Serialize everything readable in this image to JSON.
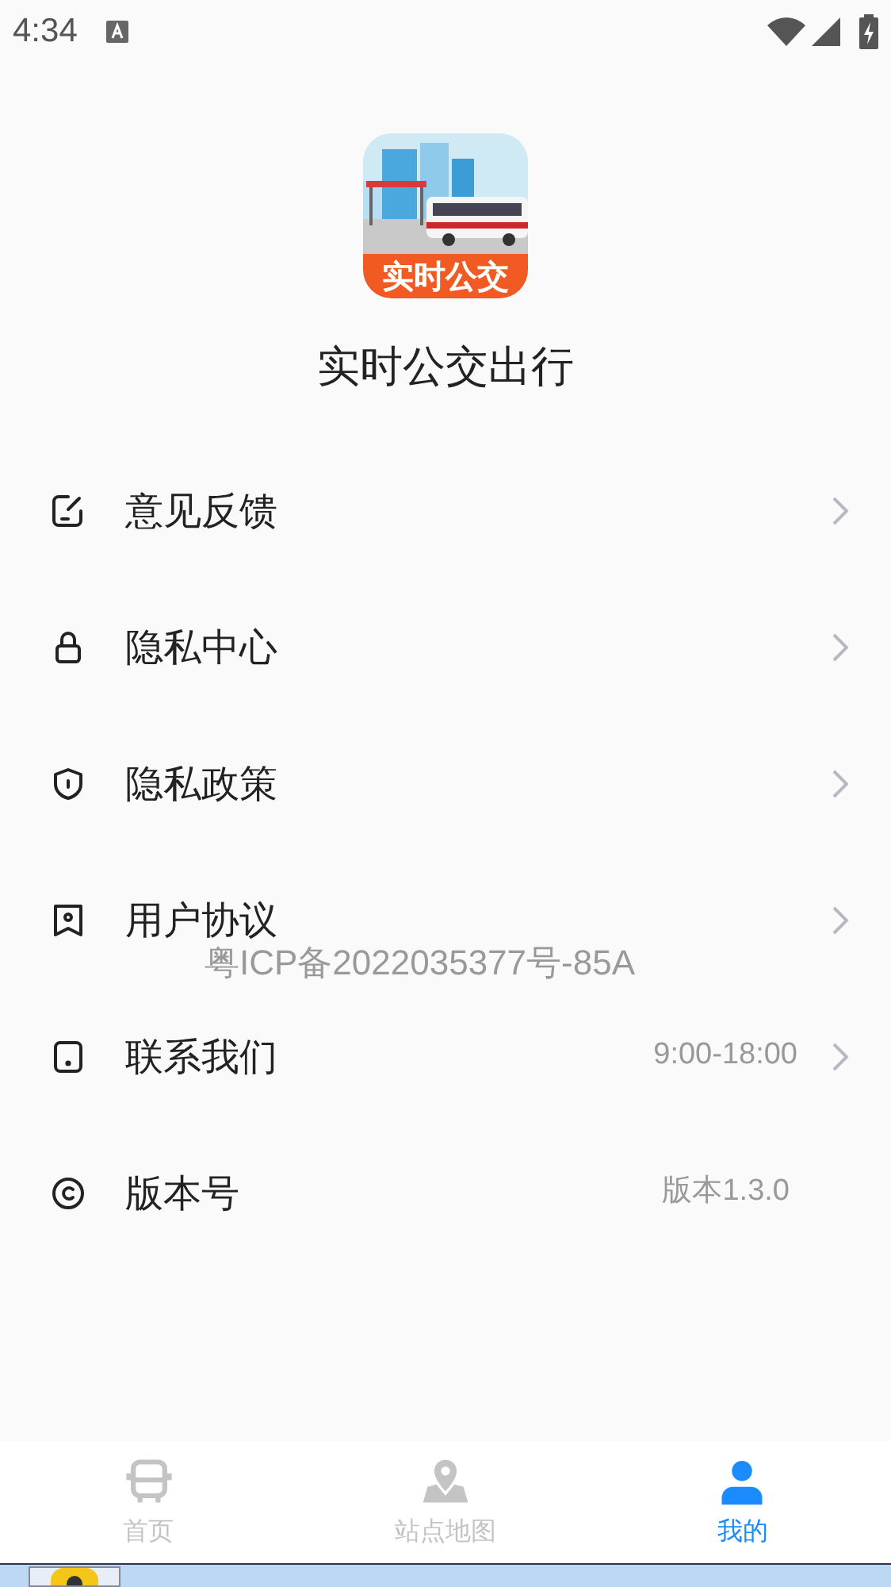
{
  "status_bar": {
    "time": "4:34"
  },
  "app": {
    "name": "实时公交出行",
    "logo_text": "实时公交"
  },
  "menu": [
    {
      "kind": "feedback",
      "label": "意见反馈",
      "chevron": true
    },
    {
      "kind": "lock",
      "label": "隐私中心",
      "chevron": true
    },
    {
      "kind": "shield",
      "label": "隐私政策",
      "chevron": true
    },
    {
      "kind": "agreement",
      "label": "用户协议",
      "chevron": true
    },
    {
      "kind": "phone",
      "label": "联系我们",
      "value": "9:00-18:00",
      "chevron": true
    },
    {
      "kind": "copyright",
      "label": "版本号",
      "value": "版本1.3.0",
      "chevron": false
    }
  ],
  "icp_notice": "粤ICP备2022035377号-85A",
  "tabs": [
    {
      "kind": "bus",
      "label": "首页",
      "selected": false
    },
    {
      "kind": "map",
      "label": "站点地图",
      "selected": false
    },
    {
      "kind": "person",
      "label": "我的",
      "selected": true
    }
  ]
}
